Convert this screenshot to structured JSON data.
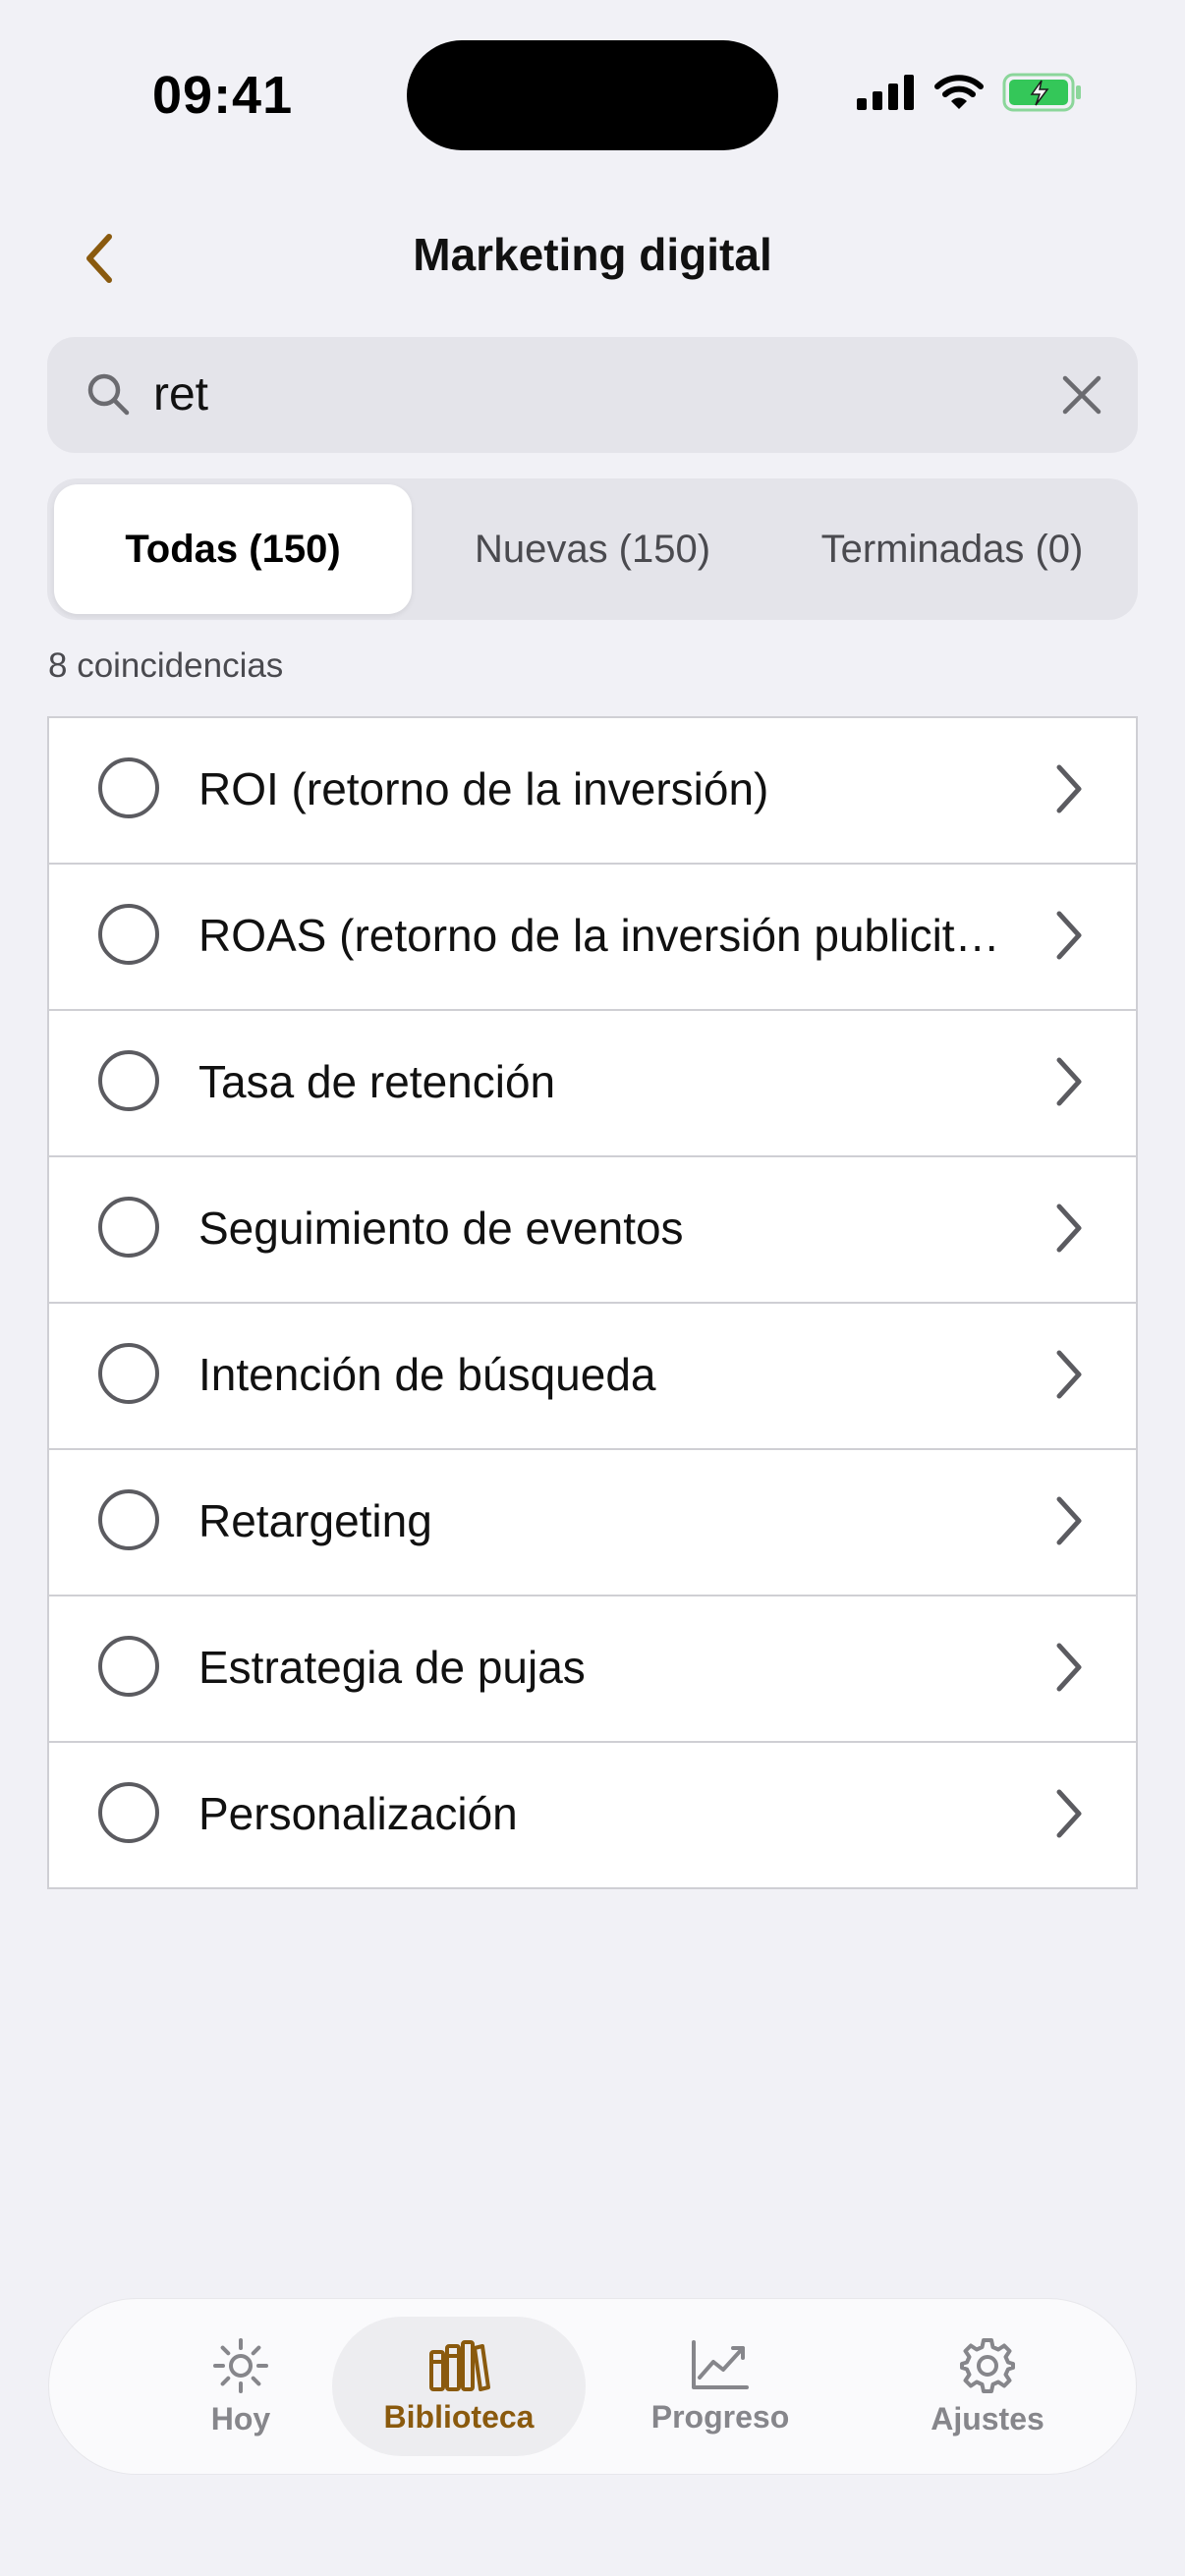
{
  "status": {
    "time": "09:41"
  },
  "header": {
    "title": "Marketing digital"
  },
  "search": {
    "value": "ret",
    "placeholder": ""
  },
  "segments": [
    {
      "label": "Todas (150)"
    },
    {
      "label": "Nuevas (150)"
    },
    {
      "label": "Terminadas (0)"
    }
  ],
  "results": {
    "count_label": "8 coincidencias"
  },
  "items": [
    {
      "label": "ROI (retorno de la inversión)"
    },
    {
      "label": "ROAS (retorno de la inversión publicit…"
    },
    {
      "label": "Tasa de retención"
    },
    {
      "label": "Seguimiento de eventos"
    },
    {
      "label": "Intención de búsqueda"
    },
    {
      "label": "Retargeting"
    },
    {
      "label": "Estrategia de pujas"
    },
    {
      "label": "Personalización"
    }
  ],
  "tabbar": {
    "tabs": [
      {
        "label": "Hoy",
        "icon": "sun-icon"
      },
      {
        "label": "Biblioteca",
        "icon": "library-icon"
      },
      {
        "label": "Progreso",
        "icon": "chart-icon"
      },
      {
        "label": "Ajustes",
        "icon": "gear-icon"
      }
    ]
  },
  "colors": {
    "accent": "#8A5A0E",
    "background": "#F1F1F6",
    "battery": "#34C759"
  }
}
